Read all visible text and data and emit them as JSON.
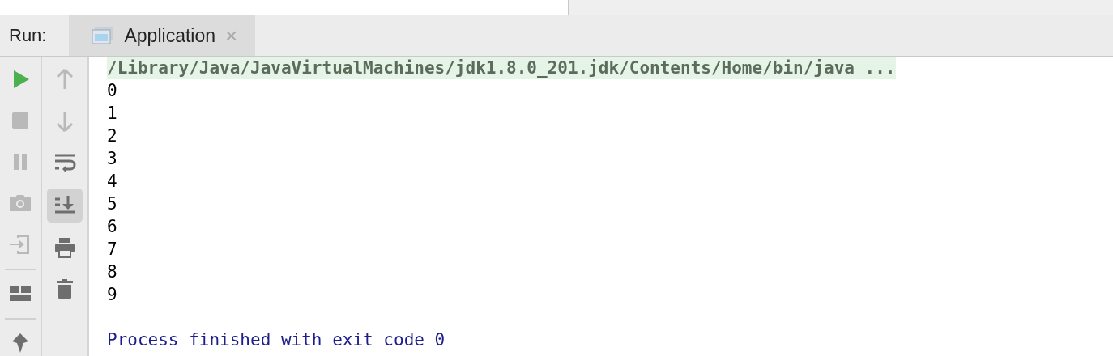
{
  "run_bar": {
    "label": "Run:",
    "tabs": [
      {
        "label": "Application",
        "selected": true,
        "close": "×"
      }
    ]
  },
  "toolbar_primary": [
    {
      "kind": "run",
      "disabled": false
    },
    {
      "kind": "stop",
      "disabled": true
    },
    {
      "kind": "pause",
      "disabled": true
    },
    {
      "kind": "camera",
      "disabled": true
    },
    {
      "kind": "exit",
      "disabled": true
    },
    {
      "kind": "separator"
    },
    {
      "kind": "layout",
      "disabled": false
    },
    {
      "kind": "separator"
    },
    {
      "kind": "pin",
      "disabled": false
    }
  ],
  "toolbar_secondary": [
    {
      "kind": "up",
      "disabled": true,
      "on": false
    },
    {
      "kind": "down",
      "disabled": true,
      "on": false
    },
    {
      "kind": "wrap",
      "disabled": false,
      "on": false
    },
    {
      "kind": "scroll-end",
      "disabled": false,
      "on": true
    },
    {
      "kind": "print",
      "disabled": false,
      "on": false
    },
    {
      "kind": "trash",
      "disabled": false,
      "on": false
    }
  ],
  "console": {
    "lines": [
      {
        "kind": "command",
        "text": "/Library/Java/JavaVirtualMachines/jdk1.8.0_201.jdk/Contents/Home/bin/java ..."
      },
      {
        "kind": "output",
        "text": "0"
      },
      {
        "kind": "output",
        "text": "1"
      },
      {
        "kind": "output",
        "text": "2"
      },
      {
        "kind": "output",
        "text": "3"
      },
      {
        "kind": "output",
        "text": "4"
      },
      {
        "kind": "output",
        "text": "5"
      },
      {
        "kind": "output",
        "text": "6"
      },
      {
        "kind": "output",
        "text": "7"
      },
      {
        "kind": "output",
        "text": "8"
      },
      {
        "kind": "output",
        "text": "9"
      },
      {
        "kind": "blank"
      },
      {
        "kind": "system",
        "text": "Process finished with exit code 0"
      }
    ]
  }
}
